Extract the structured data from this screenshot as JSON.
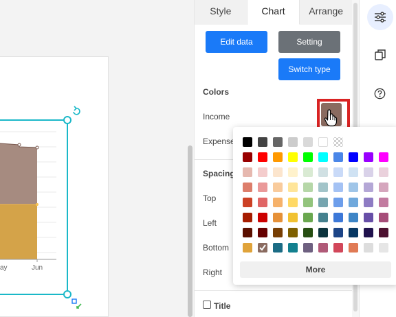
{
  "tabs": [
    "Style",
    "Chart",
    "Arrange"
  ],
  "active_tab": "Chart",
  "buttons": {
    "edit_data": "Edit data",
    "setting": "Setting",
    "switch_type": "Switch type"
  },
  "sections": {
    "colors": "Colors",
    "spacing": "Spacing"
  },
  "labels": {
    "income": "Income",
    "expense": "Expense",
    "top": "Top",
    "left": "Left",
    "bottom": "Bottom",
    "right": "Right",
    "title": "Title"
  },
  "popup": {
    "more": "More",
    "rows": [
      [
        "#000000",
        "#434343",
        "#666666",
        "#cccccc",
        "#d9d9d9",
        "#ffffff",
        "checker",
        "",
        "",
        "",
        ""
      ],
      [
        "#980000",
        "#ff0000",
        "#ff9900",
        "#ffff00",
        "#00ff00",
        "#00ffff",
        "#4a86e8",
        "#0000ff",
        "#9900ff",
        "#ff00ff",
        ""
      ],
      [
        "#e6b8af",
        "#f4cccc",
        "#fce5cd",
        "#fff2cc",
        "#d9ead3",
        "#d0e0e3",
        "#c9daf8",
        "#cfe2f3",
        "#d9d2e9",
        "#ead1dc",
        ""
      ],
      [
        "#dd7e6b",
        "#ea9999",
        "#f9cb9c",
        "#ffe599",
        "#b6d7a8",
        "#a2c4c9",
        "#a4c2f4",
        "#9fc5e8",
        "#b4a7d6",
        "#d5a6bd",
        ""
      ],
      [
        "#cc4125",
        "#e06666",
        "#f6b26b",
        "#ffd966",
        "#93c47d",
        "#76a5af",
        "#6d9eeb",
        "#6fa8dc",
        "#8e7cc3",
        "#c27ba0",
        ""
      ],
      [
        "#a61c00",
        "#cc0000",
        "#e69138",
        "#f1c232",
        "#6aa84f",
        "#45818e",
        "#3c78d8",
        "#3d85c6",
        "#674ea7",
        "#a64d79",
        ""
      ],
      [
        "#5b0f00",
        "#660000",
        "#783f04",
        "#7f6000",
        "#274e13",
        "#0c343d",
        "#1c4587",
        "#073763",
        "#20124d",
        "#4c1130",
        ""
      ],
      [
        "#e0a33a",
        "#8a6b60",
        "#1b6c85",
        "#13808f",
        "#6e6080",
        "#b05a78",
        "#d2475a",
        "#e07a55",
        "#dddddd",
        "#e6e6e6",
        ""
      ]
    ],
    "selected": "#8a6b60"
  },
  "chart_data": {
    "type": "area",
    "categories": [
      "May",
      "Jun"
    ],
    "x_tick_labels": [
      "ay",
      "Jun"
    ],
    "series": [
      {
        "name": "Income",
        "color": "#d4a349"
      },
      {
        "name": "Expense",
        "color": "#a68b80"
      }
    ]
  },
  "icons": {
    "settings": "sliders-icon",
    "copy": "copy-icon",
    "help": "help-icon",
    "rotate": "rotate-icon",
    "resize": "resize-icon",
    "cursor": "hand-pointer-icon"
  }
}
